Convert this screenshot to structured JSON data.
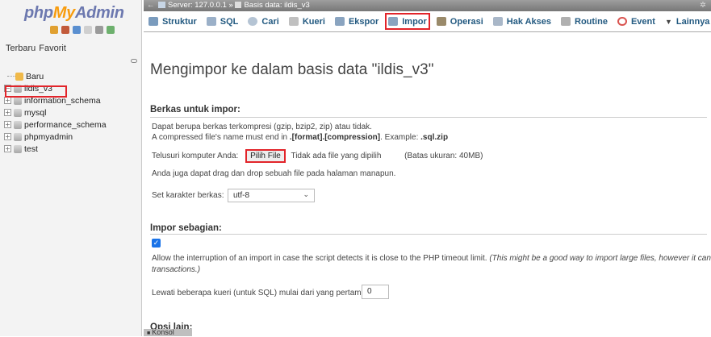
{
  "nav": {
    "logo": {
      "php": "php",
      "my": "My",
      "admin": "Admin"
    },
    "recent_tabs": [
      "Terbaru",
      "Favorit"
    ],
    "tree": [
      {
        "label": "Baru",
        "type": "new"
      },
      {
        "label": "ildis_v3",
        "type": "db",
        "selected": true
      },
      {
        "label": "information_schema",
        "type": "db"
      },
      {
        "label": "mysql",
        "type": "db"
      },
      {
        "label": "performance_schema",
        "type": "db"
      },
      {
        "label": "phpmyadmin",
        "type": "db"
      },
      {
        "label": "test",
        "type": "db"
      }
    ]
  },
  "topbar": {
    "server": "Server: 127.0.0.1",
    "separator": "»",
    "database": "Basis data: ildis_v3"
  },
  "tabs": [
    {
      "label": "Struktur",
      "color": "#7a9bbd"
    },
    {
      "label": "SQL",
      "color": "#9bb0c8"
    },
    {
      "label": "Cari",
      "color": "#b5c4d4"
    },
    {
      "label": "Kueri",
      "color": "#c0c0c0"
    },
    {
      "label": "Ekspor",
      "color": "#8aa4c0"
    },
    {
      "label": "Impor",
      "color": "#8aa4c0",
      "active": true
    },
    {
      "label": "Operasi",
      "color": "#9a8a6a"
    },
    {
      "label": "Hak Akses",
      "color": "#a9b7c8"
    },
    {
      "label": "Routine",
      "color": "#b0b0b0"
    },
    {
      "label": "Event",
      "color": "#d9534f"
    },
    {
      "label": "Lainnya",
      "color": "#444"
    }
  ],
  "main": {
    "title": "Mengimpor ke dalam basis data \"ildis_v3\"",
    "file_section": {
      "heading": "Berkas untuk impor:",
      "line1": "Dapat berupa berkas terkompresi (gzip, bzip2, zip) atau tidak.",
      "line2_pre": "A compressed file's name must end in ",
      "line2_bold": ".[format].[compression]",
      "line2_mid": ". Example: ",
      "line2_ex": ".sql.zip",
      "browse_label": "Telusuri komputer Anda:",
      "choose_file_button": "Pilih File",
      "no_file": "Tidak ada file yang dipilih",
      "size_limit": "(Batas ukuran: 40MB)",
      "drag_drop": "Anda juga dapat drag dan drop sebuah file pada halaman manapun.",
      "charset_label": "Set karakter berkas:",
      "charset_value": "utf-8"
    },
    "partial_section": {
      "heading": "Impor sebagian:",
      "checked": true,
      "allow_text": "Allow the interruption of an import in case the script detects it is close to the PHP timeout limit.",
      "allow_italic": "(This might be a good way to import large files, however it can break",
      "allow_italic2": "transactions.)",
      "skip_label": "Lewati beberapa kueri (untuk SQL) mulai dari yang pertama:",
      "skip_value": "0"
    },
    "other_section": {
      "heading": "Opsi lain:"
    }
  },
  "console": {
    "label": "Konsol"
  }
}
